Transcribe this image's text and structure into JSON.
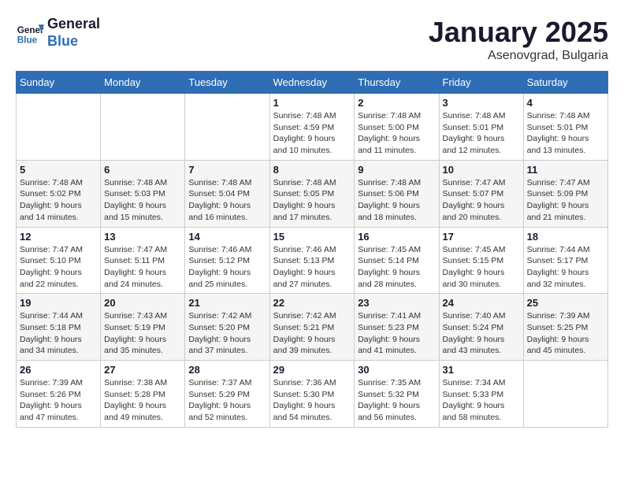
{
  "logo": {
    "line1": "General",
    "line2": "Blue"
  },
  "title": "January 2025",
  "subtitle": "Asenovgrad, Bulgaria",
  "weekdays": [
    "Sunday",
    "Monday",
    "Tuesday",
    "Wednesday",
    "Thursday",
    "Friday",
    "Saturday"
  ],
  "weeks": [
    [
      {
        "num": "",
        "info": ""
      },
      {
        "num": "",
        "info": ""
      },
      {
        "num": "",
        "info": ""
      },
      {
        "num": "1",
        "info": "Sunrise: 7:48 AM\nSunset: 4:59 PM\nDaylight: 9 hours and 10 minutes."
      },
      {
        "num": "2",
        "info": "Sunrise: 7:48 AM\nSunset: 5:00 PM\nDaylight: 9 hours and 11 minutes."
      },
      {
        "num": "3",
        "info": "Sunrise: 7:48 AM\nSunset: 5:01 PM\nDaylight: 9 hours and 12 minutes."
      },
      {
        "num": "4",
        "info": "Sunrise: 7:48 AM\nSunset: 5:01 PM\nDaylight: 9 hours and 13 minutes."
      }
    ],
    [
      {
        "num": "5",
        "info": "Sunrise: 7:48 AM\nSunset: 5:02 PM\nDaylight: 9 hours and 14 minutes."
      },
      {
        "num": "6",
        "info": "Sunrise: 7:48 AM\nSunset: 5:03 PM\nDaylight: 9 hours and 15 minutes."
      },
      {
        "num": "7",
        "info": "Sunrise: 7:48 AM\nSunset: 5:04 PM\nDaylight: 9 hours and 16 minutes."
      },
      {
        "num": "8",
        "info": "Sunrise: 7:48 AM\nSunset: 5:05 PM\nDaylight: 9 hours and 17 minutes."
      },
      {
        "num": "9",
        "info": "Sunrise: 7:48 AM\nSunset: 5:06 PM\nDaylight: 9 hours and 18 minutes."
      },
      {
        "num": "10",
        "info": "Sunrise: 7:47 AM\nSunset: 5:07 PM\nDaylight: 9 hours and 20 minutes."
      },
      {
        "num": "11",
        "info": "Sunrise: 7:47 AM\nSunset: 5:09 PM\nDaylight: 9 hours and 21 minutes."
      }
    ],
    [
      {
        "num": "12",
        "info": "Sunrise: 7:47 AM\nSunset: 5:10 PM\nDaylight: 9 hours and 22 minutes."
      },
      {
        "num": "13",
        "info": "Sunrise: 7:47 AM\nSunset: 5:11 PM\nDaylight: 9 hours and 24 minutes."
      },
      {
        "num": "14",
        "info": "Sunrise: 7:46 AM\nSunset: 5:12 PM\nDaylight: 9 hours and 25 minutes."
      },
      {
        "num": "15",
        "info": "Sunrise: 7:46 AM\nSunset: 5:13 PM\nDaylight: 9 hours and 27 minutes."
      },
      {
        "num": "16",
        "info": "Sunrise: 7:45 AM\nSunset: 5:14 PM\nDaylight: 9 hours and 28 minutes."
      },
      {
        "num": "17",
        "info": "Sunrise: 7:45 AM\nSunset: 5:15 PM\nDaylight: 9 hours and 30 minutes."
      },
      {
        "num": "18",
        "info": "Sunrise: 7:44 AM\nSunset: 5:17 PM\nDaylight: 9 hours and 32 minutes."
      }
    ],
    [
      {
        "num": "19",
        "info": "Sunrise: 7:44 AM\nSunset: 5:18 PM\nDaylight: 9 hours and 34 minutes."
      },
      {
        "num": "20",
        "info": "Sunrise: 7:43 AM\nSunset: 5:19 PM\nDaylight: 9 hours and 35 minutes."
      },
      {
        "num": "21",
        "info": "Sunrise: 7:42 AM\nSunset: 5:20 PM\nDaylight: 9 hours and 37 minutes."
      },
      {
        "num": "22",
        "info": "Sunrise: 7:42 AM\nSunset: 5:21 PM\nDaylight: 9 hours and 39 minutes."
      },
      {
        "num": "23",
        "info": "Sunrise: 7:41 AM\nSunset: 5:23 PM\nDaylight: 9 hours and 41 minutes."
      },
      {
        "num": "24",
        "info": "Sunrise: 7:40 AM\nSunset: 5:24 PM\nDaylight: 9 hours and 43 minutes."
      },
      {
        "num": "25",
        "info": "Sunrise: 7:39 AM\nSunset: 5:25 PM\nDaylight: 9 hours and 45 minutes."
      }
    ],
    [
      {
        "num": "26",
        "info": "Sunrise: 7:39 AM\nSunset: 5:26 PM\nDaylight: 9 hours and 47 minutes."
      },
      {
        "num": "27",
        "info": "Sunrise: 7:38 AM\nSunset: 5:28 PM\nDaylight: 9 hours and 49 minutes."
      },
      {
        "num": "28",
        "info": "Sunrise: 7:37 AM\nSunset: 5:29 PM\nDaylight: 9 hours and 52 minutes."
      },
      {
        "num": "29",
        "info": "Sunrise: 7:36 AM\nSunset: 5:30 PM\nDaylight: 9 hours and 54 minutes."
      },
      {
        "num": "30",
        "info": "Sunrise: 7:35 AM\nSunset: 5:32 PM\nDaylight: 9 hours and 56 minutes."
      },
      {
        "num": "31",
        "info": "Sunrise: 7:34 AM\nSunset: 5:33 PM\nDaylight: 9 hours and 58 minutes."
      },
      {
        "num": "",
        "info": ""
      }
    ]
  ]
}
